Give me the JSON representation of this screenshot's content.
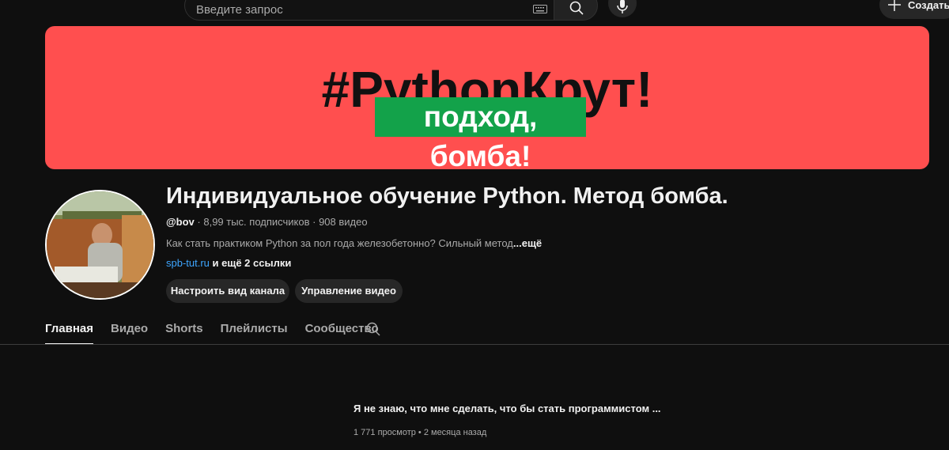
{
  "header": {
    "search_placeholder": "Введите запрос",
    "create_label": "Создать"
  },
  "banner": {
    "title": "#PythonКрут!",
    "subtitle": "подход, бомба!",
    "colors": {
      "background": "#ff4f4f",
      "subtitle_background": "#13a24a"
    }
  },
  "channel": {
    "title": "Индивидуальное обучение Python. Метод бомба.",
    "handle": "@bov",
    "stats": " · 8,99 тыс. подписчиков · 908 видео",
    "description": "Как стать практиком Python за пол года железобетонно? Сильный метод",
    "description_more": "...ещё",
    "link": "spb-tut.ru",
    "more_links": " и ещё 2 ссылки",
    "buttons": {
      "customize": "Настроить вид канала",
      "manage": "Управление видео"
    }
  },
  "tabs": [
    {
      "label": "Главная",
      "active": true
    },
    {
      "label": "Видео"
    },
    {
      "label": "Shorts"
    },
    {
      "label": "Плейлисты"
    },
    {
      "label": "Сообщество"
    }
  ],
  "video": {
    "title": "Я не знаю, что мне сделать, что бы стать программистом ...",
    "meta": "1 771 просмотр • 2 месяца назад"
  }
}
